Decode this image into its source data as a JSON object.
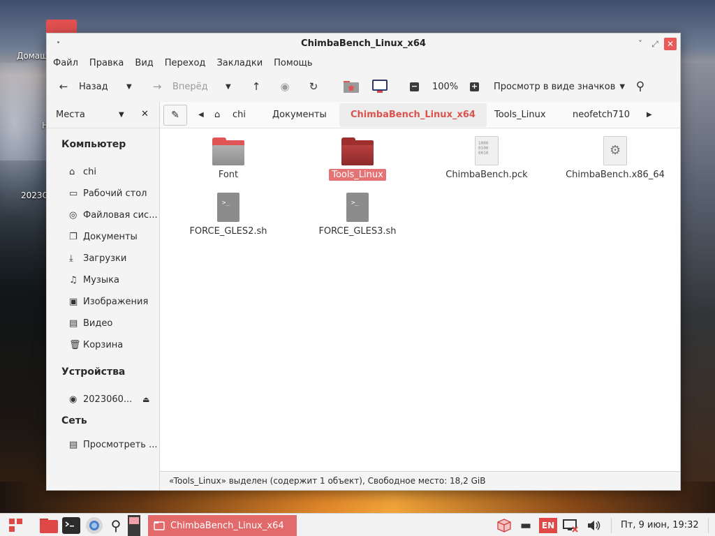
{
  "desktop": {
    "label_home": "Домаш",
    "label_2023": "2023С",
    "label_h": "Н"
  },
  "window": {
    "title": "ChimbaBench_Linux_x64",
    "min_glyph": "˅",
    "max_glyph": "⤢",
    "close_glyph": "✕"
  },
  "menu": [
    "Файл",
    "Правка",
    "Вид",
    "Переход",
    "Закладки",
    "Помощь"
  ],
  "toolbar": {
    "back_label": "Назад",
    "forward_label": "Вперёд",
    "zoom": "100%",
    "view_mode": "Просмотр в виде значков"
  },
  "sidebar": {
    "header": "Места",
    "sections": [
      {
        "title": "Компьютер",
        "items": [
          {
            "label": "chi",
            "icon": "home-icon"
          },
          {
            "label": "Рабочий стол",
            "icon": "desktop-icon"
          },
          {
            "label": "Файловая сис...",
            "icon": "disk-icon"
          },
          {
            "label": "Документы",
            "icon": "documents-icon"
          },
          {
            "label": "Загрузки",
            "icon": "download-icon"
          },
          {
            "label": "Музыка",
            "icon": "music-icon"
          },
          {
            "label": "Изображения",
            "icon": "image-icon"
          },
          {
            "label": "Видео",
            "icon": "video-icon"
          },
          {
            "label": "Корзина",
            "icon": "trash-icon"
          }
        ]
      },
      {
        "title": "Устройства",
        "items": [
          {
            "label": "2023060...",
            "icon": "optical-disc-icon"
          }
        ]
      },
      {
        "title": "Сеть",
        "items": [
          {
            "label": "Просмотреть ...",
            "icon": "network-icon"
          }
        ]
      }
    ]
  },
  "pathbar": {
    "crumbs": [
      "chi",
      "Документы",
      "ChimbaBench_Linux_x64",
      "Tools_Linux",
      "neofetch710"
    ],
    "active_index": 2
  },
  "files": [
    {
      "name": "Font",
      "type": "folder",
      "selected": false
    },
    {
      "name": "Tools_Linux",
      "type": "folder",
      "selected": true
    },
    {
      "name": "ChimbaBench.pck",
      "type": "binary",
      "selected": false
    },
    {
      "name": "ChimbaBench.x86_64",
      "type": "executable",
      "selected": false
    },
    {
      "name": "FORCE_GLES2.sh",
      "type": "script",
      "selected": false
    },
    {
      "name": "FORCE_GLES3.sh",
      "type": "script",
      "selected": false
    }
  ],
  "binary_glyph": "1000\n0100\n0010",
  "script_glyph": ">_",
  "status": "«Tools_Linux» выделен (содержит 1 объект), Свободное место: 18,2 GiB",
  "taskbar": {
    "active_window": "ChimbaBench_Linux_x64",
    "lang": "EN",
    "clock": "Пт, 9 июн, 19:32"
  },
  "colors": {
    "accent": "#e26a6a",
    "selected_folder": "#9e2f2f",
    "active_crumb": "#d9534f"
  }
}
